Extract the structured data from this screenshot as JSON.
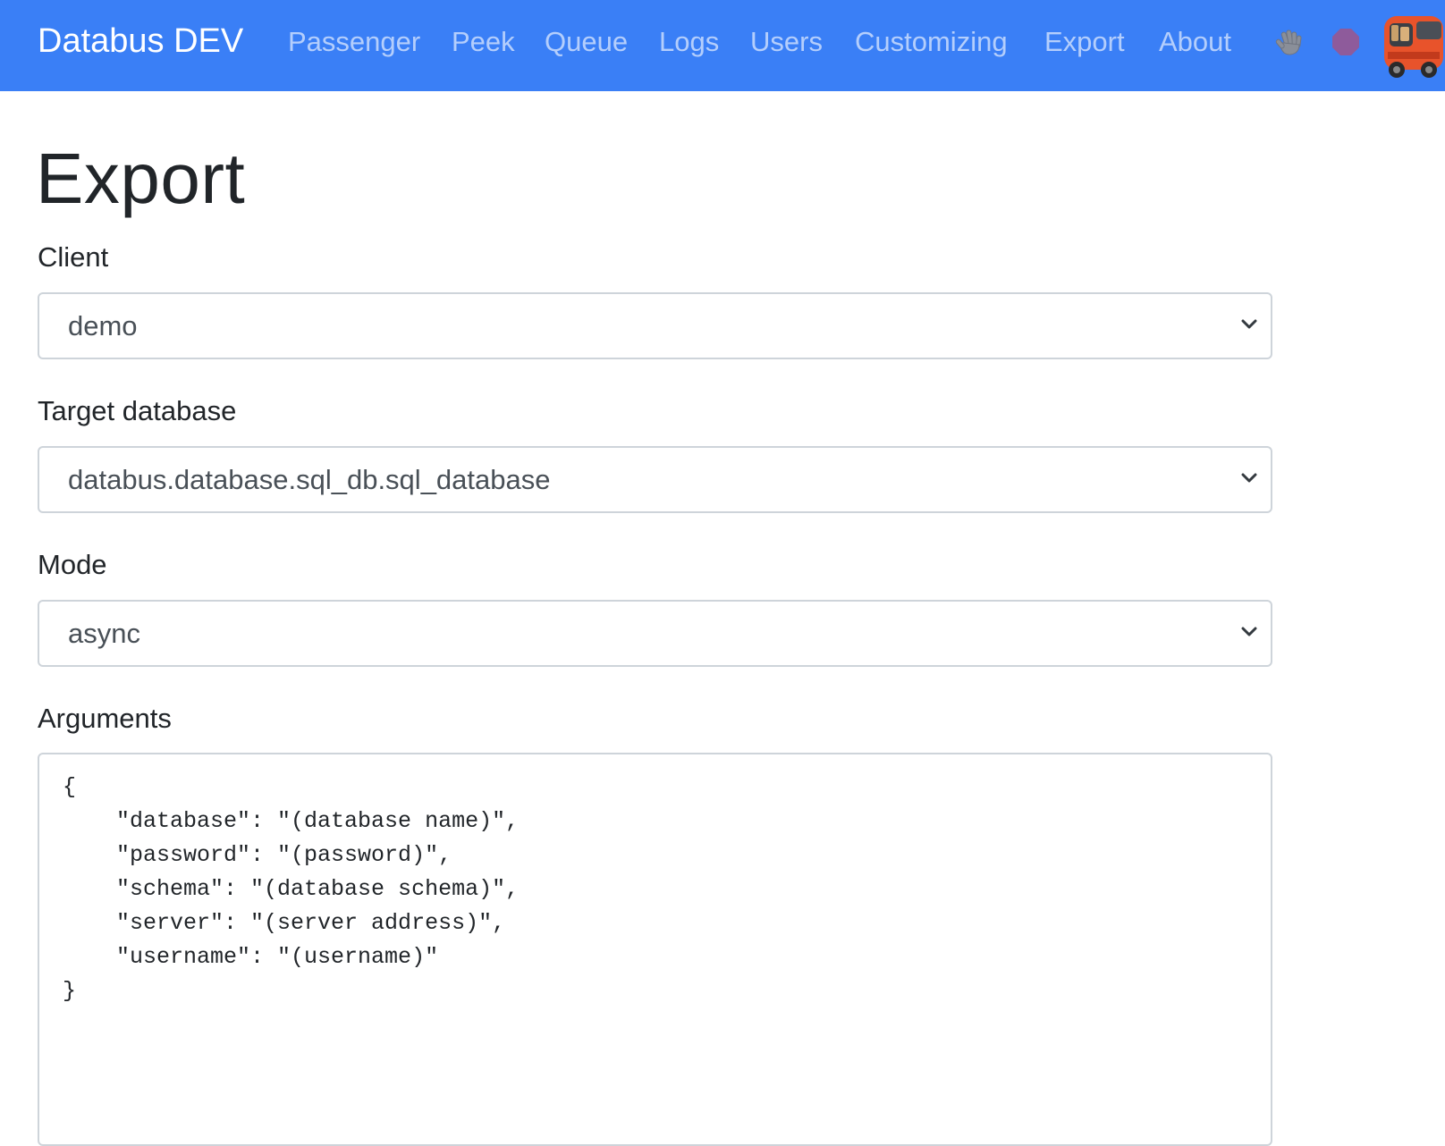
{
  "navbar": {
    "brand": "Databus DEV",
    "items": [
      {
        "label": "Passenger"
      },
      {
        "label": "Peek"
      },
      {
        "label": "Queue"
      },
      {
        "label": "Logs"
      },
      {
        "label": "Users"
      },
      {
        "label": "Customizing"
      },
      {
        "label": "Export"
      },
      {
        "label": "About"
      }
    ],
    "icons": [
      "waving-hand-icon",
      "stop-icon",
      "bus-logo-icon"
    ],
    "colors": {
      "background": "#3a7ff6",
      "stop": "#8e5b9b"
    }
  },
  "page": {
    "title": "Export"
  },
  "form": {
    "client": {
      "label": "Client",
      "value": "demo"
    },
    "target_database": {
      "label": "Target database",
      "value": "databus.database.sql_db.sql_database"
    },
    "mode": {
      "label": "Mode",
      "value": "async"
    },
    "arguments": {
      "label": "Arguments",
      "value": "{\n    \"database\": \"(database name)\",\n    \"password\": \"(password)\",\n    \"schema\": \"(database schema)\",\n    \"server\": \"(server address)\",\n    \"username\": \"(username)\"\n}"
    }
  }
}
